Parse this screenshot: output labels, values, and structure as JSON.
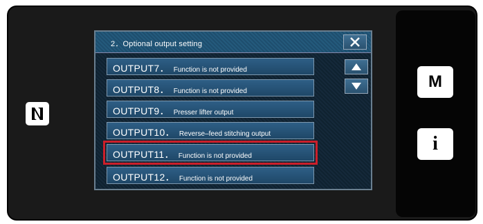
{
  "dialog": {
    "title": "2．Optional output setting"
  },
  "items": [
    {
      "code": "OUTPUT7．",
      "desc": "Function is not provided"
    },
    {
      "code": "OUTPUT8．",
      "desc": "Function is not provided"
    },
    {
      "code": "OUTPUT9．",
      "desc": "Presser lifter output"
    },
    {
      "code": "OUTPUT10．",
      "desc": "Reverse–feed stitching output"
    },
    {
      "code": "OUTPUT11．",
      "desc": "Function is not provided"
    },
    {
      "code": "OUTPUT12．",
      "desc": "Function is not provided"
    }
  ],
  "selected_item": "OUTPUT11．",
  "side_buttons": {
    "m_label": "M",
    "info_label": "i"
  },
  "icons": {
    "nfc": "nfc-icon",
    "close": "close-icon",
    "scroll_up": "arrow-up-icon",
    "scroll_down": "arrow-down-icon"
  },
  "colors": {
    "highlight": "#cc1f2a",
    "button": "#2a5270"
  }
}
